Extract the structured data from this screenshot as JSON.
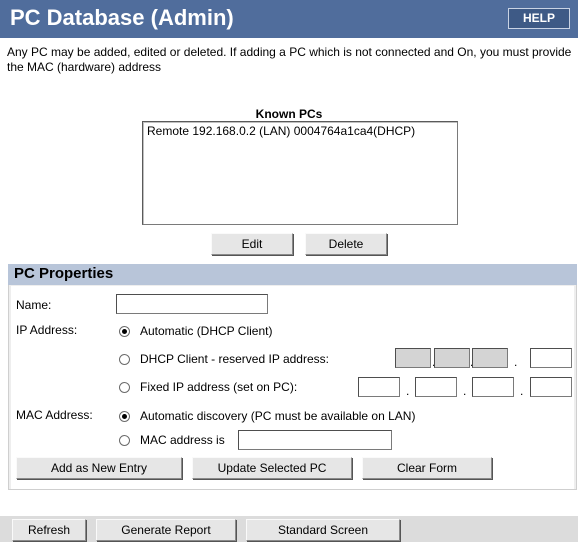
{
  "header": {
    "title": "PC Database (Admin)",
    "help_label": "HELP"
  },
  "intro": "Any PC may be added, edited or deleted. If adding a PC which is not connected and On, you must provide the MAC (hardware) address",
  "known_pcs": {
    "label": "Known PCs",
    "items": [
      "Remote 192.168.0.2 (LAN) 0004764a1ca4(DHCP)"
    ],
    "edit_label": "Edit",
    "delete_label": "Delete"
  },
  "properties": {
    "heading": "PC Properties",
    "name_label": "Name:",
    "name_value": "",
    "ip_label": "IP Address:",
    "ip_options": [
      {
        "label": "Automatic (DHCP Client)",
        "selected": true
      },
      {
        "label": "DHCP Client - reserved IP address:",
        "selected": false
      },
      {
        "label": "Fixed IP address (set on PC):",
        "selected": false
      }
    ],
    "mac_label": "MAC Address:",
    "mac_options": [
      {
        "label": "Automatic discovery (PC must be available on LAN)",
        "selected": true
      },
      {
        "label": "MAC address is",
        "selected": false
      }
    ],
    "mac_value": "",
    "add_label": "Add as New Entry",
    "update_label": "Update Selected PC",
    "clear_label": "Clear Form"
  },
  "footer": {
    "refresh_label": "Refresh",
    "report_label": "Generate Report",
    "standard_label": "Standard Screen"
  },
  "colors": {
    "titlebar": "#506d9c",
    "panel_header": "#b8c5d9",
    "button_face": "#e6e6e6"
  }
}
